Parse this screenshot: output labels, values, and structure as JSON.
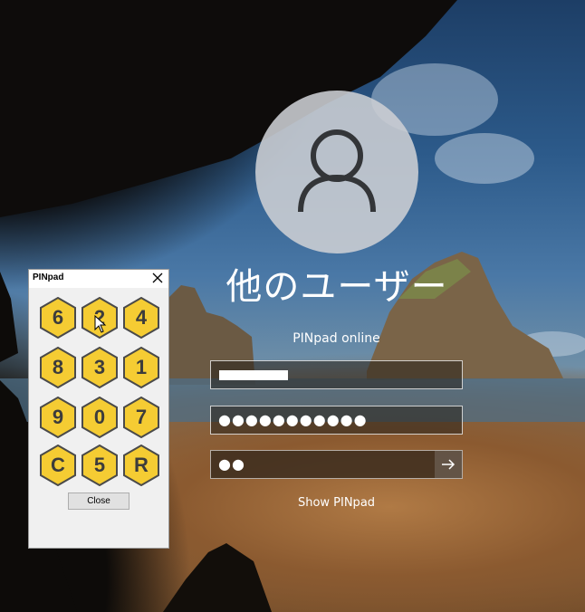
{
  "login": {
    "username": "他のユーザー",
    "provider_label": "PINpad online",
    "password_mask": "●●●●●●●●●●●",
    "pin_mask": "●●",
    "show_pinpad": "Show PINpad",
    "submit_icon": "arrow-right-icon",
    "avatar_icon": "user-icon"
  },
  "pinpad": {
    "title": "PINpad",
    "keys": [
      "6",
      "2",
      "4",
      "8",
      "3",
      "1",
      "9",
      "0",
      "7",
      "C",
      "5",
      "R"
    ],
    "close_label": "Close",
    "close_icon": "close-icon"
  },
  "colors": {
    "key_fill": "#f5cc33",
    "key_stroke": "#4a4a4a",
    "text": "#ffffff"
  }
}
